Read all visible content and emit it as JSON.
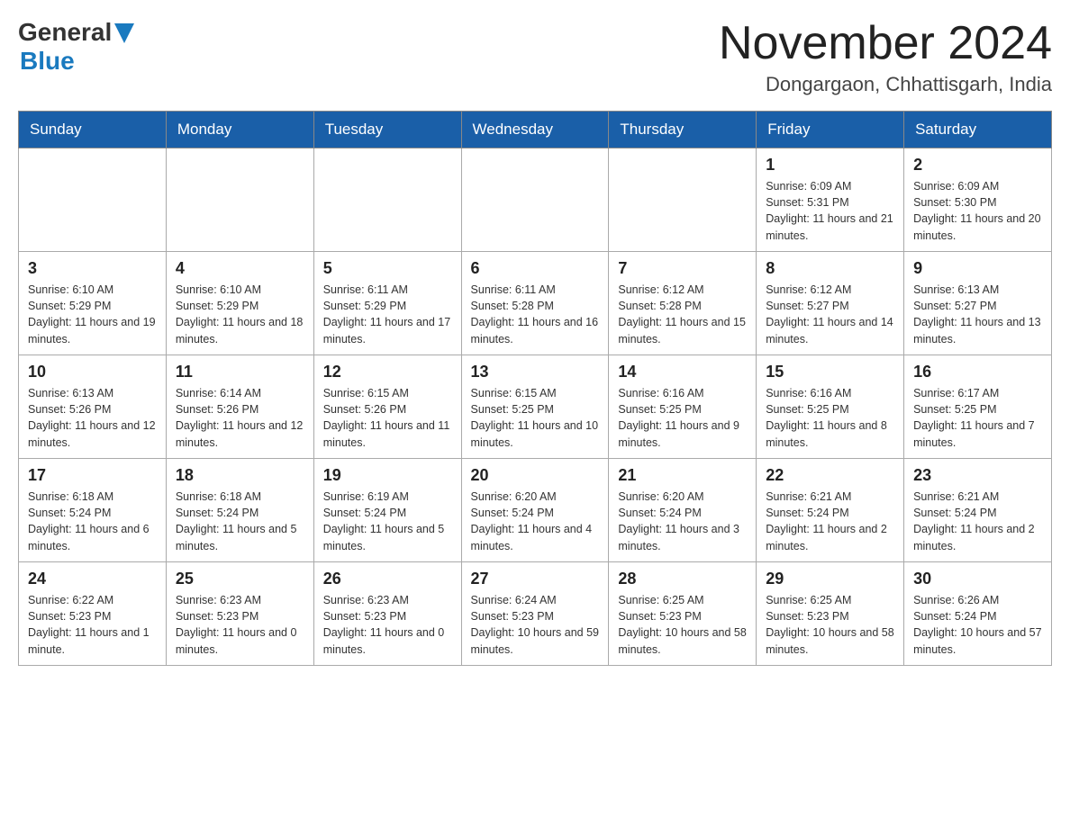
{
  "header": {
    "month_title": "November 2024",
    "location": "Dongargaon, Chhattisgarh, India",
    "logo_general": "General",
    "logo_blue": "Blue"
  },
  "days_of_week": [
    "Sunday",
    "Monday",
    "Tuesday",
    "Wednesday",
    "Thursday",
    "Friday",
    "Saturday"
  ],
  "weeks": [
    {
      "cells": [
        {
          "empty": true
        },
        {
          "empty": true
        },
        {
          "empty": true
        },
        {
          "empty": true
        },
        {
          "empty": true
        },
        {
          "day": 1,
          "sunrise": "6:09 AM",
          "sunset": "5:31 PM",
          "daylight": "11 hours and 21 minutes."
        },
        {
          "day": 2,
          "sunrise": "6:09 AM",
          "sunset": "5:30 PM",
          "daylight": "11 hours and 20 minutes."
        }
      ]
    },
    {
      "cells": [
        {
          "day": 3,
          "sunrise": "6:10 AM",
          "sunset": "5:29 PM",
          "daylight": "11 hours and 19 minutes."
        },
        {
          "day": 4,
          "sunrise": "6:10 AM",
          "sunset": "5:29 PM",
          "daylight": "11 hours and 18 minutes."
        },
        {
          "day": 5,
          "sunrise": "6:11 AM",
          "sunset": "5:29 PM",
          "daylight": "11 hours and 17 minutes."
        },
        {
          "day": 6,
          "sunrise": "6:11 AM",
          "sunset": "5:28 PM",
          "daylight": "11 hours and 16 minutes."
        },
        {
          "day": 7,
          "sunrise": "6:12 AM",
          "sunset": "5:28 PM",
          "daylight": "11 hours and 15 minutes."
        },
        {
          "day": 8,
          "sunrise": "6:12 AM",
          "sunset": "5:27 PM",
          "daylight": "11 hours and 14 minutes."
        },
        {
          "day": 9,
          "sunrise": "6:13 AM",
          "sunset": "5:27 PM",
          "daylight": "11 hours and 13 minutes."
        }
      ]
    },
    {
      "cells": [
        {
          "day": 10,
          "sunrise": "6:13 AM",
          "sunset": "5:26 PM",
          "daylight": "11 hours and 12 minutes."
        },
        {
          "day": 11,
          "sunrise": "6:14 AM",
          "sunset": "5:26 PM",
          "daylight": "11 hours and 12 minutes."
        },
        {
          "day": 12,
          "sunrise": "6:15 AM",
          "sunset": "5:26 PM",
          "daylight": "11 hours and 11 minutes."
        },
        {
          "day": 13,
          "sunrise": "6:15 AM",
          "sunset": "5:25 PM",
          "daylight": "11 hours and 10 minutes."
        },
        {
          "day": 14,
          "sunrise": "6:16 AM",
          "sunset": "5:25 PM",
          "daylight": "11 hours and 9 minutes."
        },
        {
          "day": 15,
          "sunrise": "6:16 AM",
          "sunset": "5:25 PM",
          "daylight": "11 hours and 8 minutes."
        },
        {
          "day": 16,
          "sunrise": "6:17 AM",
          "sunset": "5:25 PM",
          "daylight": "11 hours and 7 minutes."
        }
      ]
    },
    {
      "cells": [
        {
          "day": 17,
          "sunrise": "6:18 AM",
          "sunset": "5:24 PM",
          "daylight": "11 hours and 6 minutes."
        },
        {
          "day": 18,
          "sunrise": "6:18 AM",
          "sunset": "5:24 PM",
          "daylight": "11 hours and 5 minutes."
        },
        {
          "day": 19,
          "sunrise": "6:19 AM",
          "sunset": "5:24 PM",
          "daylight": "11 hours and 5 minutes."
        },
        {
          "day": 20,
          "sunrise": "6:20 AM",
          "sunset": "5:24 PM",
          "daylight": "11 hours and 4 minutes."
        },
        {
          "day": 21,
          "sunrise": "6:20 AM",
          "sunset": "5:24 PM",
          "daylight": "11 hours and 3 minutes."
        },
        {
          "day": 22,
          "sunrise": "6:21 AM",
          "sunset": "5:24 PM",
          "daylight": "11 hours and 2 minutes."
        },
        {
          "day": 23,
          "sunrise": "6:21 AM",
          "sunset": "5:24 PM",
          "daylight": "11 hours and 2 minutes."
        }
      ]
    },
    {
      "cells": [
        {
          "day": 24,
          "sunrise": "6:22 AM",
          "sunset": "5:23 PM",
          "daylight": "11 hours and 1 minute."
        },
        {
          "day": 25,
          "sunrise": "6:23 AM",
          "sunset": "5:23 PM",
          "daylight": "11 hours and 0 minutes."
        },
        {
          "day": 26,
          "sunrise": "6:23 AM",
          "sunset": "5:23 PM",
          "daylight": "11 hours and 0 minutes."
        },
        {
          "day": 27,
          "sunrise": "6:24 AM",
          "sunset": "5:23 PM",
          "daylight": "10 hours and 59 minutes."
        },
        {
          "day": 28,
          "sunrise": "6:25 AM",
          "sunset": "5:23 PM",
          "daylight": "10 hours and 58 minutes."
        },
        {
          "day": 29,
          "sunrise": "6:25 AM",
          "sunset": "5:23 PM",
          "daylight": "10 hours and 58 minutes."
        },
        {
          "day": 30,
          "sunrise": "6:26 AM",
          "sunset": "5:24 PM",
          "daylight": "10 hours and 57 minutes."
        }
      ]
    }
  ]
}
